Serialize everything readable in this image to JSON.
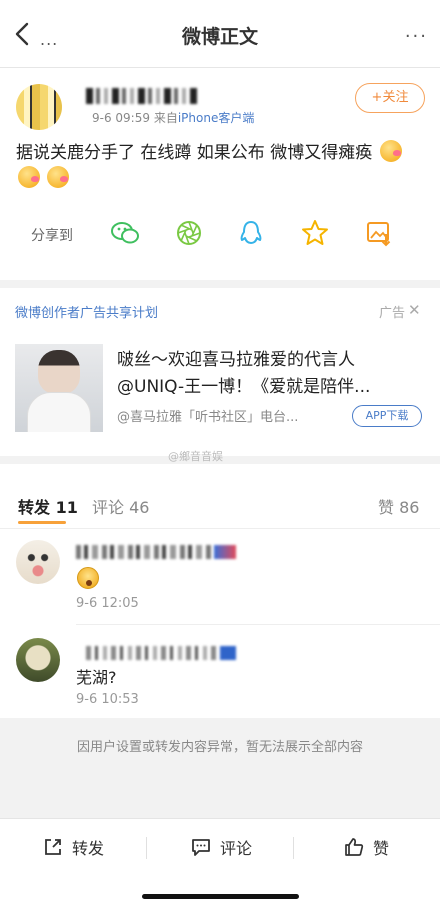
{
  "nav": {
    "title": "微博正文",
    "back_dots": "...",
    "more": "···"
  },
  "post": {
    "meta_time": "9-6 09:59",
    "meta_from": "来自",
    "meta_source": "iPhone客户端",
    "follow_label": "+关注",
    "text": "据说关鹿分手了 在线蹲 如果公布 微博又得瘫痪",
    "share_label": "分享到"
  },
  "ad": {
    "plan_label": "微博创作者广告共享计划",
    "tag": "广告",
    "close": "✕",
    "line1": "啵丝～欢迎喜马拉雅爱的代言人",
    "line2": "@UNIQ-王一博！《爱就是陪伴...",
    "sub": "@喜马拉雅「听书社区」电台...",
    "app_button": "APP下载"
  },
  "watermark": "@鄉音音娱",
  "tabs": {
    "repost": "转发 11",
    "comment": "评论 46",
    "like": "赞 86"
  },
  "comments": [
    {
      "time": "9-6 12:05"
    },
    {
      "text": "芜湖?",
      "time": "9-6 10:53"
    }
  ],
  "notice": "因用户设置或转发内容异常，暂无法展示全部内容",
  "bottom": {
    "repost": "转发",
    "comment": "评论",
    "like": "赞"
  },
  "colors": {
    "accent": "#f7a13a",
    "link": "#4a7cc8"
  }
}
